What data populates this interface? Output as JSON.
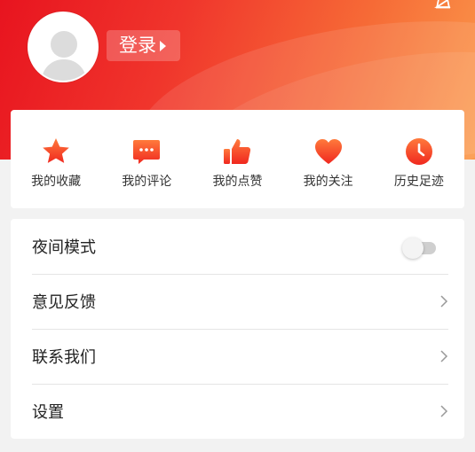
{
  "header": {
    "login_label": "登录",
    "gradient_start": "#e8141f",
    "gradient_end": "#fb9a4c"
  },
  "shortcuts": [
    {
      "label": "我的收藏",
      "icon": "star-icon"
    },
    {
      "label": "我的评论",
      "icon": "comment-icon"
    },
    {
      "label": "我的点赞",
      "icon": "thumbs-up-icon"
    },
    {
      "label": "我的关注",
      "icon": "heart-icon"
    },
    {
      "label": "历史足迹",
      "icon": "clock-icon"
    }
  ],
  "menu": {
    "night_mode": {
      "label": "夜间模式",
      "enabled": false
    },
    "items": [
      {
        "label": "意见反馈"
      },
      {
        "label": "联系我们"
      },
      {
        "label": "设置"
      }
    ]
  },
  "colors": {
    "accent": "#f0352c",
    "icon_gradient_top": "#ff7a3c",
    "icon_gradient_bottom": "#f0281f"
  }
}
